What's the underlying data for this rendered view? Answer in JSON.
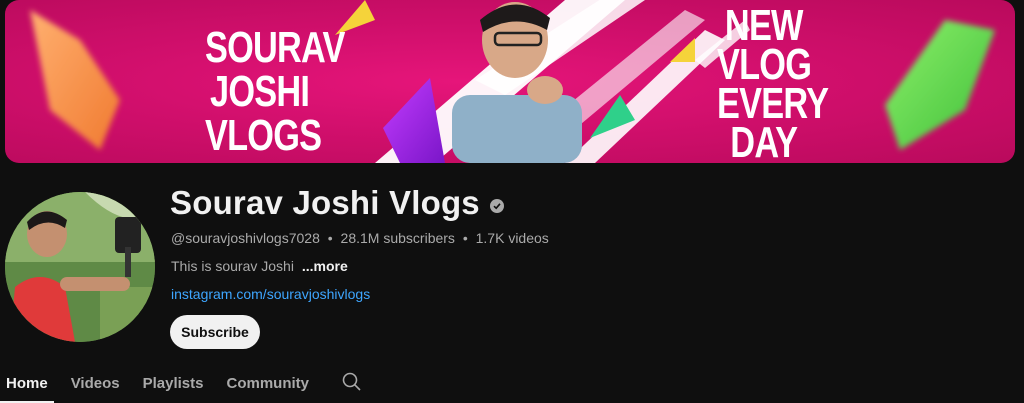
{
  "banner": {
    "title": "SOURAV\nJOSHI\nVLOGS",
    "tagline": "NEW\nVLOG\nEVERY\nDAY"
  },
  "channel": {
    "name": "Sourav Joshi Vlogs",
    "handle": "@souravjoshivlogs7028",
    "subscribers": "28.1M subscribers",
    "videos": "1.7K videos",
    "separator": "•",
    "description": "This is sourav Joshi",
    "more_label": "...more",
    "link": "instagram.com/souravjoshivlogs",
    "subscribe_label": "Subscribe"
  },
  "tabs": [
    {
      "label": "Home",
      "active": true
    },
    {
      "label": "Videos",
      "active": false
    },
    {
      "label": "Playlists",
      "active": false
    },
    {
      "label": "Community",
      "active": false
    }
  ],
  "icons": {
    "verified": "verified-check-icon",
    "search": "search-icon"
  },
  "colors": {
    "background": "#0f0f0f",
    "banner_magenta": "#d10f6c",
    "link": "#3ea6ff",
    "text_secondary": "#aaaaaa"
  }
}
